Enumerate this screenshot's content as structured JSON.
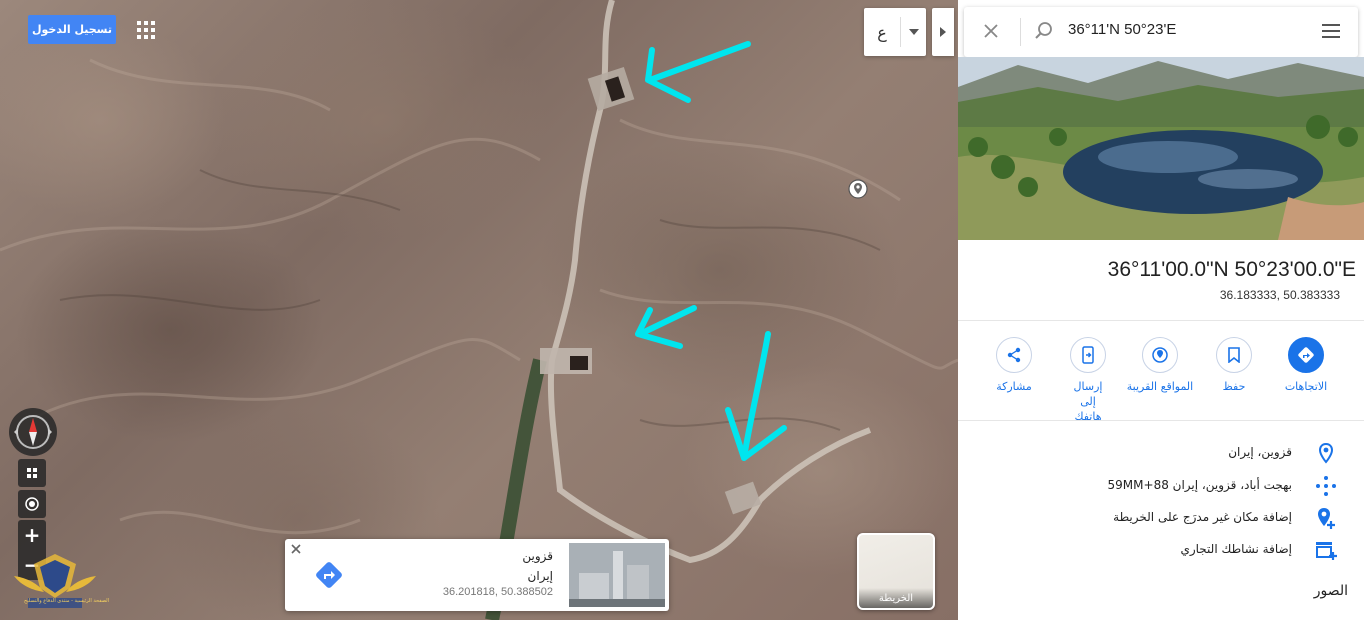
{
  "topbar": {
    "login_label": "تسجيل الدخول",
    "apps_icon": "apps-grid-icon",
    "language_value": "ع",
    "language_caret_icon": "caret-down-icon",
    "collapse_icon": "collapse-arrow-icon"
  },
  "map": {
    "pin_icon": "location-pin-icon",
    "overlay_color": "#00e5ee",
    "watermark_caption": "الصفحة الرئيسية - منتدى الدفاع والتسليح"
  },
  "controls": {
    "compass_icon": "compass-icon",
    "layers_icon": "layers-icon",
    "locate_icon": "locate-icon",
    "zoom_in": "+",
    "zoom_out": "−"
  },
  "place_card": {
    "name": "قزوين",
    "country": "إيران",
    "coords": "36.201818, 50.388502",
    "directions_icon": "directions-icon",
    "close_icon": "close-icon"
  },
  "map_type": {
    "label": "الخريطة"
  },
  "panel": {
    "search_value": "36°11'N 50°23'E",
    "title": "36°11'00.0\"N 50°23'00.0\"E",
    "subtitle": "36.183333, 50.383333",
    "actions": [
      {
        "label": "الاتجاهات",
        "icon": "directions-icon"
      },
      {
        "label": "حفظ",
        "icon": "bookmark-icon"
      },
      {
        "label": "المواقع القريبة",
        "icon": "nearby-icon"
      },
      {
        "label": "إرسال إلى هاتفك",
        "icon": "send-to-phone-icon"
      },
      {
        "label": "مشاركة",
        "icon": "share-icon"
      }
    ],
    "info": [
      {
        "text": "قزوين، إيران",
        "icon": "location-pin-icon"
      },
      {
        "text": "59MM+88 بهجت أباد، قزوين، إيران",
        "icon": "plus-code-icon"
      },
      {
        "text": "إضافة مكان غير مدرَج على الخريطة",
        "icon": "add-place-icon"
      },
      {
        "text": "إضافة نشاطك التجاري",
        "icon": "add-business-icon"
      }
    ],
    "photos_heading": "الصور",
    "accent": "#1a73e8"
  }
}
